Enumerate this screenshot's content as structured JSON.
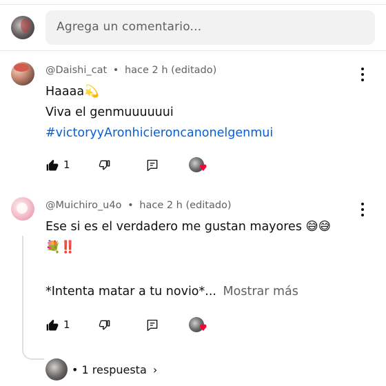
{
  "composer": {
    "placeholder": "Agrega un comentario..."
  },
  "comments": [
    {
      "author": "@Daishi_cat",
      "separator": "•",
      "time": "hace 2 h (editado)",
      "lines": [
        "Haaaa💫",
        "Viva el genmuuuuuui"
      ],
      "hashtag": "#victoryyAronhicieroncanonelgenmui",
      "likes": "1"
    },
    {
      "author": "@Muichiro_u4o",
      "separator": "•",
      "time": "hace 2 h (editado)",
      "lines": [
        "Ese si es el verdadero me gustan mayores 😅😅",
        "💐‼️",
        "*Intenta matar a tu novio*..."
      ],
      "show_more": "Mostrar más",
      "likes": "1"
    }
  ],
  "replies": {
    "separator": "•",
    "label": "1 respuesta",
    "chevron": "›"
  },
  "icons": {
    "like": "thumbs-up-icon",
    "dislike": "thumbs-down-icon",
    "reply": "reply-icon",
    "more": "more-vert-icon",
    "heart": "heart-icon",
    "heart_color": "#ff0033",
    "link_color": "#065fd4"
  }
}
